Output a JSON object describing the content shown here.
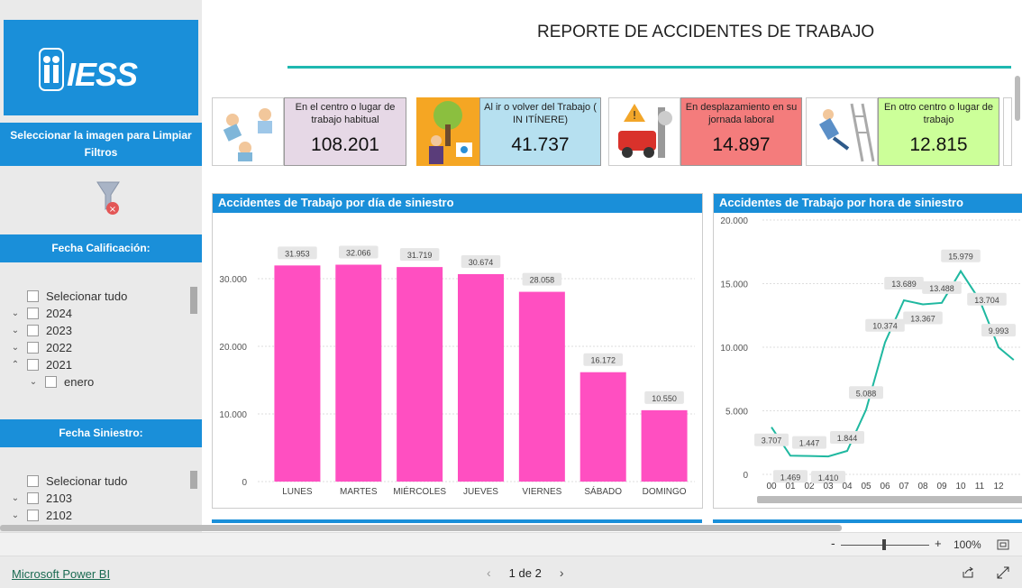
{
  "header": {
    "title": "REPORTE DE ACCIDENTES DE TRABAJO"
  },
  "sidebar": {
    "logo_text": "IESS",
    "clear_filters_label": "Seleccionar la imagen para Limpiar Filtros",
    "fecha_calificacion": {
      "label": "Fecha Calificación:",
      "items": [
        "Selecionar tudo",
        "2024",
        "2023",
        "2022",
        "2021",
        "enero"
      ]
    },
    "fecha_siniestro": {
      "label": "Fecha Siniestro:",
      "items": [
        "Selecionar tudo",
        "2103",
        "2102"
      ]
    }
  },
  "kpis": [
    {
      "label": "En el centro o lugar de trabajo habitual",
      "value": "108.201",
      "color": "#e6d8e6"
    },
    {
      "label": "Al ir o volver del Trabajo ( IN ITÍNERE)",
      "value": "41.737",
      "color": "#b6e0f0"
    },
    {
      "label": "En desplazamiento en su jornada laboral",
      "value": "14.897",
      "color": "#f47c7c"
    },
    {
      "label": "En otro centro o lugar de trabajo",
      "value": "12.815",
      "color": "#ccff99"
    }
  ],
  "chart_day": {
    "title": "Accidentes de Trabajo por día de siniestro"
  },
  "chart_hour": {
    "title": "Accidentes de Trabajo por hora de siniestro"
  },
  "chart_data": [
    {
      "type": "bar",
      "title": "Accidentes de Trabajo por día de siniestro",
      "categories": [
        "LUNES",
        "MARTES",
        "MIÉRCOLES",
        "JUEVES",
        "VIERNES",
        "SÁBADO",
        "DOMINGO"
      ],
      "values": [
        31953,
        32066,
        31719,
        30674,
        28058,
        16172,
        10550
      ],
      "data_labels": [
        "31.953",
        "32.066",
        "31.719",
        "30.674",
        "28.058",
        "16.172",
        "10.550"
      ],
      "yticks": [
        "0",
        "10.000",
        "20.000",
        "30.000"
      ],
      "ylim": [
        0,
        36000
      ],
      "color": "#ff4fc1"
    },
    {
      "type": "line",
      "title": "Accidentes de Trabajo por hora de siniestro",
      "categories": [
        "00",
        "01",
        "02",
        "03",
        "04",
        "05",
        "06",
        "07",
        "08",
        "09",
        "10",
        "11",
        "12"
      ],
      "values": [
        3707,
        1469,
        1447,
        1410,
        1844,
        5088,
        10374,
        13689,
        13367,
        13488,
        15979,
        13704,
        9993
      ],
      "data_labels": [
        "3.707",
        "1.469",
        "1.447",
        "1.410",
        "1.844",
        "5.088",
        "10.374",
        "13.689",
        "13.367",
        "13.488",
        "15.979",
        "13.704",
        "9.993"
      ],
      "yticks": [
        "0",
        "5.000",
        "10.000",
        "15.000",
        "20.000"
      ],
      "ylim": [
        0,
        20000
      ],
      "color": "#1fb8a0"
    }
  ],
  "footer": {
    "link": "Microsoft Power BI",
    "page": "1 de 2",
    "zoom": "100%"
  }
}
